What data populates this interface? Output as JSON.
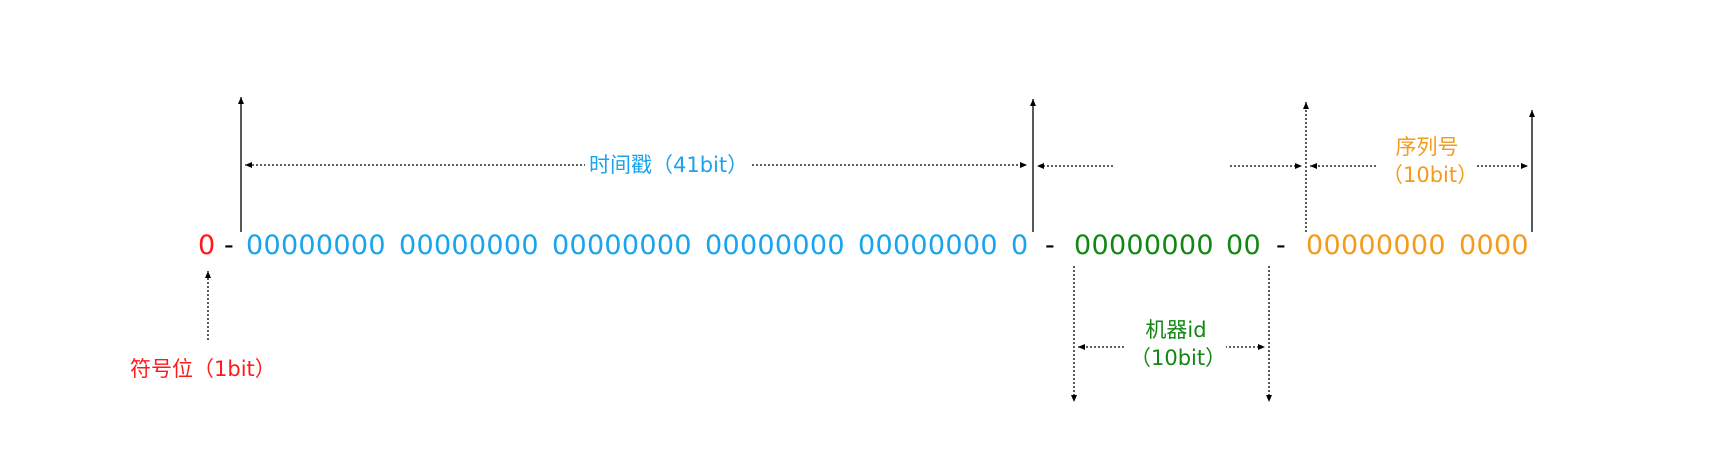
{
  "colors": {
    "sign": "#ff1a1a",
    "timestamp": "#1aa3ee",
    "machine": "#118811",
    "sequence": "#f59a1a",
    "arrow": "#000000"
  },
  "sign": {
    "bits": "0",
    "label": "符号位（1bit）"
  },
  "timestamp": {
    "groups": [
      "00000000",
      "00000000",
      "00000000",
      "00000000",
      "00000000",
      "0"
    ],
    "label": "时间戳（41bit）"
  },
  "machine": {
    "groups": [
      "00000000",
      "00"
    ],
    "label_line1": "机器id",
    "label_line2": "（10bit）"
  },
  "sequence": {
    "groups": [
      "00000000",
      "0000"
    ],
    "label_line1": "序列号",
    "label_line2": "（10bit）"
  },
  "separator": "-"
}
